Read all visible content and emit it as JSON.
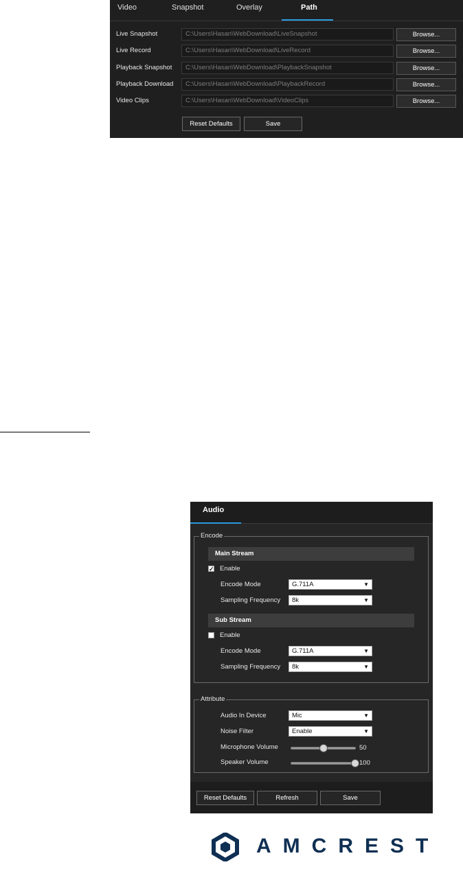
{
  "path_panel": {
    "tabs": [
      {
        "label": "Video"
      },
      {
        "label": "Snapshot"
      },
      {
        "label": "Overlay"
      },
      {
        "label": "Path"
      }
    ],
    "rows": [
      {
        "label": "Live Snapshot",
        "value": "C:\\Users\\Hasan\\WebDownload\\LiveSnapshot",
        "button": "Browse..."
      },
      {
        "label": "Live Record",
        "value": "C:\\Users\\Hasan\\WebDownload\\LiveRecord",
        "button": "Browse..."
      },
      {
        "label": "Playback Snapshot",
        "value": "C:\\Users\\Hasan\\WebDownload\\PlaybackSnapshot",
        "button": "Browse..."
      },
      {
        "label": "Playback Download",
        "value": "C:\\Users\\Hasan\\WebDownload\\PlaybackRecord",
        "button": "Browse..."
      },
      {
        "label": "Video Clips",
        "value": "C:\\Users\\Hasan\\WebDownload\\VideoClips",
        "button": "Browse..."
      }
    ],
    "reset_label": "Reset Defaults",
    "save_label": "Save"
  },
  "audio_panel": {
    "tab_label": "Audio",
    "encode": {
      "legend": "Encode",
      "main_stream": {
        "title": "Main Stream",
        "enable_label": "Enable",
        "enabled": true,
        "encode_mode_label": "Encode Mode",
        "encode_mode_value": "G.711A",
        "sampling_label": "Sampling Frequency",
        "sampling_value": "8k"
      },
      "sub_stream": {
        "title": "Sub Stream",
        "enable_label": "Enable",
        "enabled": false,
        "encode_mode_label": "Encode Mode",
        "encode_mode_value": "G.711A",
        "sampling_label": "Sampling Frequency",
        "sampling_value": "8k"
      }
    },
    "attribute": {
      "legend": "Attribute",
      "audio_in_label": "Audio In Device",
      "audio_in_value": "Mic",
      "noise_filter_label": "Noise Filter",
      "noise_filter_value": "Enable",
      "mic_volume_label": "Microphone Volume",
      "mic_volume": "50",
      "speaker_volume_label": "Speaker Volume",
      "speaker_volume": "100"
    },
    "reset_label": "Reset Defaults",
    "refresh_label": "Refresh",
    "save_label": "Save"
  },
  "logo": {
    "text": "AMCREST",
    "color": "#0f2f53"
  },
  "colors": {
    "accent": "#2a9be0",
    "panel_bg": "#1f1f1f"
  }
}
